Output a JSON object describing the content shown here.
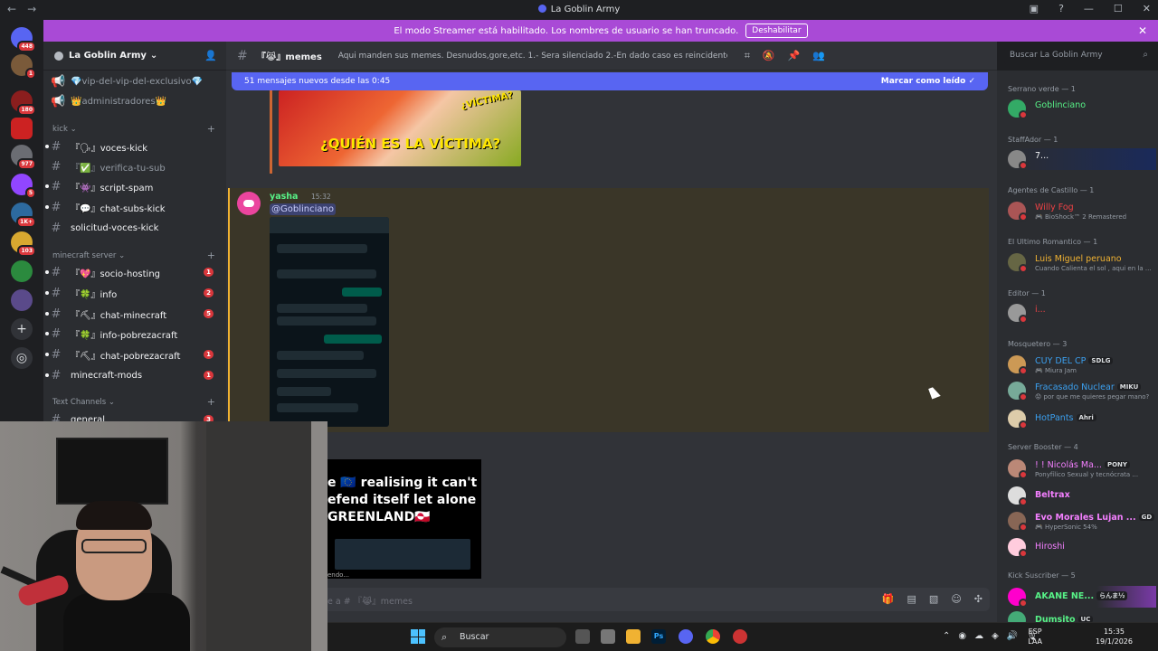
{
  "window": {
    "title": "La Goblin Army"
  },
  "banner": {
    "text": "El modo Streamer está habilitado. Los nombres de usuario se han truncado.",
    "button": "Deshabilitar"
  },
  "servers": {
    "badges": [
      "448",
      "1",
      "180",
      "977",
      "5",
      "1K+",
      "103"
    ]
  },
  "guild": {
    "name": "La Goblin Army"
  },
  "channels": {
    "top": [
      {
        "icon": "megaphone-icon",
        "label": "💎vip-del-vip-del-exclusivo💎"
      },
      {
        "icon": "megaphone-icon",
        "label": "👑administradores👑"
      }
    ],
    "categories": [
      {
        "name": "kick",
        "items": [
          {
            "label": "『🗣』voces-kick",
            "unread": true,
            "count": ""
          },
          {
            "label": "『✅』verifica-tu-sub",
            "unread": false,
            "count": ""
          },
          {
            "label": "『👾』script-spam",
            "unread": true,
            "count": ""
          },
          {
            "label": "『💬』chat-subs-kick",
            "unread": true,
            "count": ""
          },
          {
            "label": "solicitud-voces-kick",
            "unread": true,
            "count": ""
          }
        ]
      },
      {
        "name": "minecraft server",
        "items": [
          {
            "label": "『💖』socio-hosting",
            "unread": true,
            "count": "1"
          },
          {
            "label": "『🍀』info",
            "unread": true,
            "count": "2"
          },
          {
            "label": "『⛏』chat-minecraft",
            "unread": true,
            "count": "5"
          },
          {
            "label": "『🍀』info-pobrezacraft",
            "unread": true,
            "count": ""
          },
          {
            "label": "『⛏』chat-pobrezacraft",
            "unread": true,
            "count": "1"
          },
          {
            "label": "minecraft-mods",
            "unread": true,
            "count": "1"
          }
        ]
      },
      {
        "name": "Text Channels",
        "items": [
          {
            "label": "general",
            "unread": true,
            "count": "3"
          }
        ]
      }
    ]
  },
  "header": {
    "channel": "『😹』memes",
    "topic": "Aqui manden sus memes. Desnudos,gore,etc. 1.- Sera silenciado 2.-En dado caso es reincidente sera baneado",
    "search_placeholder": "Buscar La Goblin Army"
  },
  "newbar": {
    "text": "51 mensajes nuevos desde las 0:45",
    "action": "Marcar como leído"
  },
  "messages": {
    "thumb_title": "¿QUIÉN ES LA VÍCTIMA?",
    "thumb_tag": "¿VÍCTIMA?",
    "author": "yasha",
    "time": "15:32",
    "mention": "@Goblinciano",
    "video_caption": "e 🇪🇺 realising it can't efend itself let alone GREENLAND🇬🇱",
    "video_footer": "endo..."
  },
  "composer": {
    "placeholder": "e a # 『😹』memes"
  },
  "members": {
    "groups": [
      {
        "title": "Serrano verde — 1",
        "members": [
          {
            "name": "Goblinciano",
            "status": "",
            "color": "#57f287",
            "tag": ""
          }
        ]
      },
      {
        "title": "StaffAdor — 1",
        "members": [
          {
            "name": "7...",
            "status": "",
            "color": "#f2f3f5",
            "tag": ""
          }
        ]
      },
      {
        "title": "Agentes de Castillo — 1",
        "members": [
          {
            "name": "Willy Fog",
            "status": "🎮 BioShock™ 2 Remastered",
            "color": "#ed4245",
            "tag": ""
          }
        ]
      },
      {
        "title": "El Ultimo Romantico — 1",
        "members": [
          {
            "name": "Luis Miguel peruano",
            "status": "Cuando Calienta el sol , aqui en la ...",
            "color": "#f0b232",
            "tag": ""
          }
        ]
      },
      {
        "title": "Editor — 1",
        "members": [
          {
            "name": "i...",
            "status": "",
            "color": "#ed4245",
            "tag": ""
          }
        ]
      },
      {
        "title": "Mosquetero — 3",
        "members": [
          {
            "name": "CUY DEL CP",
            "status": "🎮 Miura Jam",
            "color": "#3ba0f0",
            "tag": "SDLG"
          },
          {
            "name": "Fracasado Nuclear",
            "status": "😟 por que me quieres pegar mano?",
            "color": "#3ba0f0",
            "tag": "MIKU"
          },
          {
            "name": "HotPants",
            "status": "",
            "color": "#3ba0f0",
            "tag": "Ahri"
          }
        ]
      },
      {
        "title": "Server Booster — 4",
        "members": [
          {
            "name": "! ! Nicolás Ma...",
            "status": "Ponyfílico Sexual y tecnócrata ...",
            "color": "#f47fff",
            "tag": "PONY"
          },
          {
            "name": "Beltrax",
            "status": "",
            "color": "#f47fff",
            "tag": ""
          },
          {
            "name": "Evo Morales Lujan ...",
            "status": "🎮 HyperSonic 54%",
            "color": "#f47fff",
            "tag": "GD"
          },
          {
            "name": "Hiroshi",
            "status": "",
            "color": "#f47fff",
            "tag": ""
          }
        ]
      },
      {
        "title": "Kick Suscriber — 5",
        "members": [
          {
            "name": "AKANE NE...",
            "status": "",
            "color": "#57f287",
            "tag": "らんま½"
          },
          {
            "name": "Dumsito",
            "status": "",
            "color": "#57f287",
            "tag": "UC"
          }
        ]
      }
    ]
  },
  "taskbar": {
    "search": "Buscar",
    "lang1": "ESP",
    "lang2": "LAA",
    "time": "15:35",
    "date": "19/1/2026"
  },
  "colors": {
    "accent": "#5865f2",
    "banner": "#a94ad6",
    "highlight": "#f0b232"
  }
}
